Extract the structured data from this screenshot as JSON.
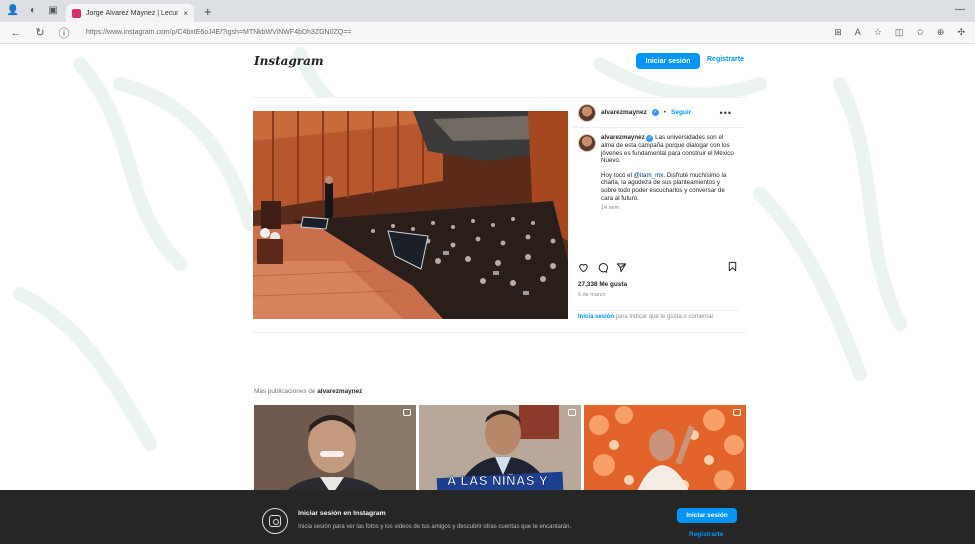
{
  "browser": {
    "tab_title": "Jorge Álvarez Máynez | Lecum",
    "tab_close": "×",
    "new_tab": "+",
    "url": "https://www.instagram.com/p/C4bxtE6oJ4E/?igsh=MTNkbWViNWF4bDh3ZGN0ZQ=="
  },
  "header": {
    "logo": "Instagram",
    "login_label": "Iniciar sesión",
    "register_label": "Registrarte"
  },
  "post": {
    "username": "alvarezmaynez",
    "verified_mark": "✓",
    "separator": "•",
    "follow_label": "Seguir",
    "more_label": "•••",
    "caption_paragraph_1": "Las universidades son el alma de esta campaña porque dialogar con los jóvenes es fundamental para construir el México Nuevo.",
    "caption_paragraph_2_prefix": "Hoy tocó el ",
    "caption_mention": "@itam_mx",
    "caption_paragraph_2_suffix": ". Disfruté muchísimo la charla, la agudeza de sus planteamientos y sobre todo poder escucharlos y conversar de cara al futuro.",
    "time_ago": "14 sem",
    "likes": "27,338 Me gusta",
    "date": "6 de marzo",
    "login_comment_link": "Inicia sesión",
    "login_comment_text": " para indicar que te gusta o comentar."
  },
  "more_posts": {
    "label_prefix": "Más publicaciones de ",
    "label_user": "alvarezmaynez",
    "thumb_text": "A LAS NIÑAS Y"
  },
  "banner": {
    "title": "Iniciar sesión en Instagram",
    "subtitle": "Inicia sesión para ver las fotos y los videos de tus amigos y descubrir otras cuentas que te encantarán.",
    "login_label": "Iniciar sesión",
    "register_label": "Registrarte"
  },
  "colors": {
    "accent": "#0095f6",
    "banner_bg": "#262626"
  }
}
